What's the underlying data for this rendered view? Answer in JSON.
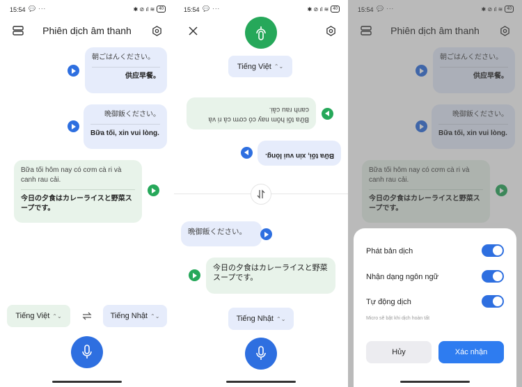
{
  "status": {
    "time": "15:54",
    "battery": "40"
  },
  "header": {
    "title": "Phiên dịch âm thanh"
  },
  "conversation": {
    "msg1": {
      "source": "朝ごはんください。",
      "translation": "供应早餐。"
    },
    "msg2": {
      "source": "晩御飯ください。",
      "translation": "Bữa tối, xin vui lòng."
    },
    "msg3": {
      "source": "Bữa tối hôm nay có cơm cà ri và canh rau cải.",
      "translation": "今日の夕食はカレーライスと野菜スープです。"
    }
  },
  "languages": {
    "left": "Tiếng Việt",
    "right": "Tiếng Nhật"
  },
  "face_to_face": {
    "top_lang": "Tiếng Việt",
    "bottom_lang": "Tiếng Nhật",
    "top_msg1": {
      "source": "Bữa tối hôm nay có cơm cà ri và canh rau cải."
    },
    "top_msg2": {
      "translation": "Bữa tối, xin vui lòng."
    },
    "bottom_msg1": {
      "source": "晩御飯ください。"
    },
    "bottom_msg2": {
      "translation": "今日の夕食はカレーライスと野菜スープです。"
    }
  },
  "settings_sheet": {
    "opt1": "Phát bản dịch",
    "opt2": "Nhận dạng ngôn ngữ",
    "opt3": "Tự động dịch",
    "hint": "Micro sẽ bật khi dịch hoàn tất",
    "cancel": "Hủy",
    "confirm": "Xác nhận",
    "toggles": {
      "opt1": true,
      "opt2": true,
      "opt3": true
    }
  },
  "colors": {
    "accent": "#2e6fe0",
    "green": "#26a85a",
    "bubble_blue": "#e6ecfb",
    "bubble_green": "#e8f3ea"
  }
}
